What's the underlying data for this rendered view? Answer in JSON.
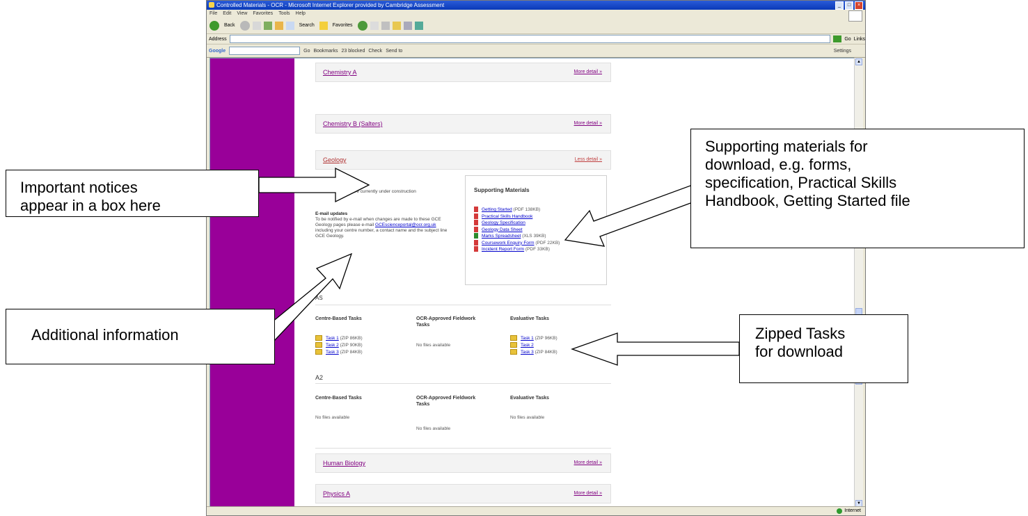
{
  "window": {
    "title": "Controlled Materials - OCR - Microsoft Internet Explorer provided by Cambridge Assessment",
    "menu": [
      "File",
      "Edit",
      "View",
      "Favorites",
      "Tools",
      "Help"
    ],
    "toolbar": {
      "back": "Back",
      "search": "Search",
      "favorites": "Favorites"
    },
    "address_label": "Address",
    "go_label": "Go",
    "links_label": "Links",
    "google": {
      "logo": "Google",
      "go": "Go",
      "bookmarks": "Bookmarks",
      "blocked": "23 blocked",
      "check": "Check",
      "send": "Send to",
      "settings": "Settings"
    },
    "status": {
      "zone": "Internet"
    }
  },
  "subjects": [
    {
      "name": "Chemistry A",
      "more": "More detail »"
    },
    {
      "name": "Chemistry B (Salters)",
      "more": "More detail »"
    },
    {
      "name": "Geology",
      "more": "Less detail »"
    }
  ],
  "geology": {
    "notice": "...are currently under construction",
    "email_heading": "E-mail updates",
    "email_text": "To be notified by e-mail when changes are made to these GCE Geology pages please e-mail",
    "email_link": "GCEscienceportal@ocr.org.uk",
    "email_text2": "including your centre number, a contact name and the subject line GCE Geology.",
    "supporting_title": "Supporting Materials",
    "supporting_items": [
      {
        "label": "Getting Started",
        "size": "(PDF 138KB)",
        "type": "pdf"
      },
      {
        "label": "Practical Skills Handbook",
        "size": "",
        "type": "pdf"
      },
      {
        "label": "Geology Specification",
        "size": "",
        "type": "pdf"
      },
      {
        "label": "Geology Data Sheet",
        "size": "",
        "type": "pdf"
      },
      {
        "label": "Marks Spreadsheet",
        "size": "(XLS 39KB)",
        "type": "xls"
      },
      {
        "label": "Coursework Enquiry Form",
        "size": "(PDF 22KB)",
        "type": "pdf"
      },
      {
        "label": "Incident Report Form",
        "size": "(PDF 33KB)",
        "type": "pdf"
      }
    ],
    "as_label": "AS",
    "a2_label": "A2",
    "columns": [
      "Centre-Based Tasks",
      "OCR-Approved Fieldwork Tasks",
      "Evaluative Tasks"
    ],
    "as_centre": [
      {
        "label": "Task 1",
        "size": "(ZIP 86KB)"
      },
      {
        "label": "Task 2",
        "size": "(ZIP 90KB)"
      },
      {
        "label": "Task 3",
        "size": "(ZIP 84KB)"
      }
    ],
    "as_fieldwork": "No files available",
    "as_evaluative": [
      {
        "label": "Task 1",
        "size": "(ZIP 96KB)"
      },
      {
        "label": "Task 2",
        "size": ""
      },
      {
        "label": "Task 3",
        "size": "(ZIP 84KB)"
      }
    ],
    "a2_centre": "No files available",
    "a2_fieldwork": "No files available",
    "a2_evaluative": "No files available"
  },
  "subjects_bottom": [
    {
      "name": "Human Biology",
      "more": "More detail »"
    },
    {
      "name": "Physics A",
      "more": "More detail »"
    }
  ],
  "callouts": {
    "notices": "Important notices appear in a box here",
    "notices_l1": "Important notices",
    "notices_l2": "appear in a box here",
    "additional": "Additional information",
    "supporting_l1": "Supporting materials for",
    "supporting_l2": "download, e.g. forms,",
    "supporting_l3": "specification, Practical Skills",
    "supporting_l4": "Handbook, Getting Started file",
    "zipped_l1": "Zipped Tasks",
    "zipped_l2": "for download"
  }
}
